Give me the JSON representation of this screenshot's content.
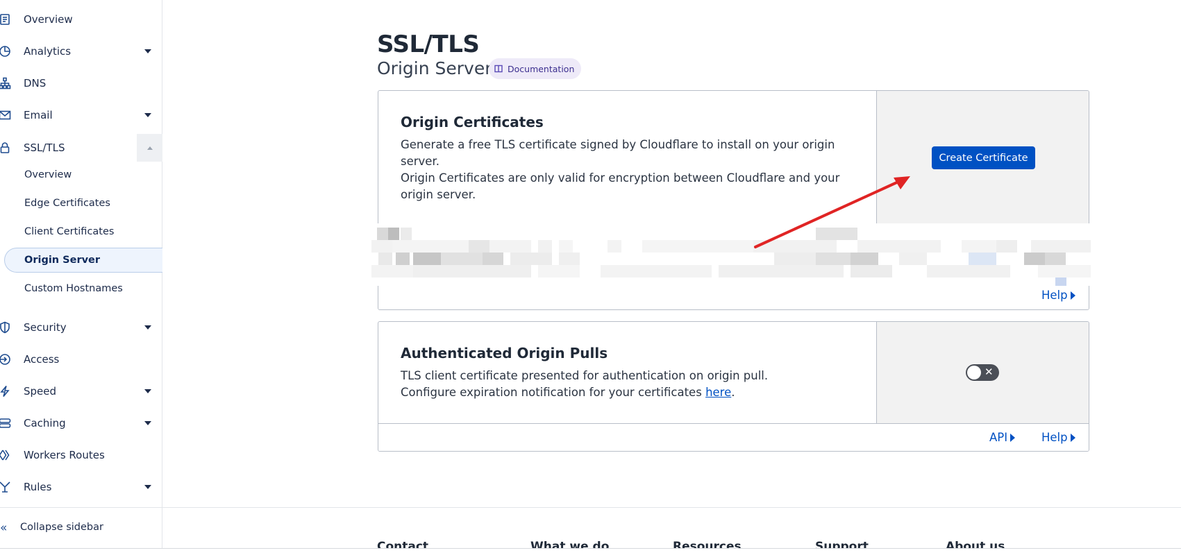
{
  "sidebar": {
    "items": [
      {
        "label": "Overview",
        "icon": "document-icon"
      },
      {
        "label": "Analytics",
        "icon": "pie-chart-icon"
      },
      {
        "label": "DNS",
        "icon": "network-icon"
      },
      {
        "label": "Email",
        "icon": "envelope-icon"
      },
      {
        "label": "SSL/TLS",
        "icon": "lock-icon"
      },
      {
        "label": "Security",
        "icon": "shield-icon"
      },
      {
        "label": "Access",
        "icon": "access-icon"
      },
      {
        "label": "Speed",
        "icon": "lightning-icon"
      },
      {
        "label": "Caching",
        "icon": "server-icon"
      },
      {
        "label": "Workers Routes",
        "icon": "workers-icon"
      },
      {
        "label": "Rules",
        "icon": "rules-icon"
      }
    ],
    "ssl_subitems": [
      {
        "label": "Overview"
      },
      {
        "label": "Edge Certificates"
      },
      {
        "label": "Client Certificates"
      },
      {
        "label": "Origin Server",
        "active": true
      },
      {
        "label": "Custom Hostnames"
      }
    ],
    "collapse_label": "Collapse sidebar"
  },
  "page": {
    "title": "SSL/TLS",
    "subtitle": "Origin Server",
    "doc_badge": "Documentation"
  },
  "origin_certificates": {
    "title": "Origin Certificates",
    "text1": "Generate a free TLS certificate signed by Cloudflare to install on your origin server.",
    "text2": "Origin Certificates are only valid for encryption between Cloudflare and your origin server.",
    "button": "Create Certificate",
    "help": "Help"
  },
  "authenticated_origin_pulls": {
    "title": "Authenticated Origin Pulls",
    "text1": "TLS client certificate presented for authentication on origin pull.",
    "text2_prefix": "Configure expiration notification for your certificates ",
    "text2_link": "here",
    "text2_suffix": ".",
    "toggle_on": false,
    "api": "API",
    "help": "Help"
  },
  "footer": {
    "columns": [
      "Contact",
      "What we do",
      "Resources",
      "Support",
      "About us"
    ]
  },
  "colors": {
    "accent": "#0051c3",
    "annotation_arrow": "#e02424"
  }
}
